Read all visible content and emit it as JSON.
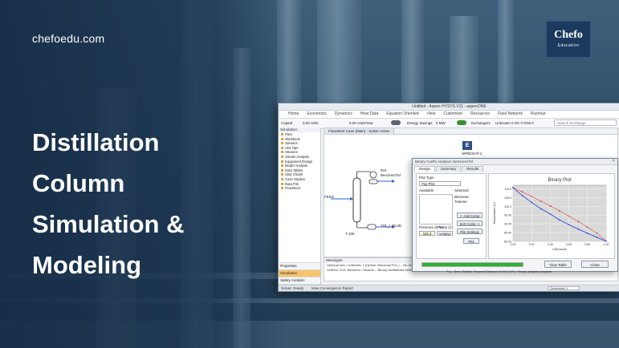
{
  "banner": {
    "site": "chefoedu.com",
    "title_lines": [
      "Distillation",
      "Column",
      "Simulation &",
      "Modeling"
    ],
    "logo_main": "Chefo",
    "logo_sub": "Education"
  },
  "window": {
    "title": "Untitled - Aspen HYSYS V11 - aspenONE",
    "menu": [
      "Home",
      "Economics",
      "Dynamics",
      "Heat Data",
      "Equation Oriented",
      "View",
      "Customize",
      "Resources",
      "Flare Network",
      "Rushout"
    ],
    "ribbon": {
      "cost_label": "Capital",
      "cost_value": "0.00 USD",
      "utility_value": "0.00 USD/Year",
      "energy_label": "Energy Savings",
      "energy_value": "0 MW",
      "exchangers_label": "Exchangers",
      "exchangers_status": "Unknown 0  OK 0  Risk 0",
      "search_placeholder": "Search Exchange"
    },
    "nav": {
      "head": "Simulation",
      "items": [
        "Files",
        "Workbook",
        "Streams",
        "Unit Ops",
        "Streams",
        "Stream Analysis",
        "Equipment Design",
        "Model Analysis",
        "Data Tables",
        "Strip Charts",
        "Case Studies",
        "Data Fits",
        "Flowsheet"
      ],
      "bottom": [
        "Properties",
        "Simulation",
        "Safety Analysis",
        "Energy Analysis"
      ]
    },
    "flowsheet": {
      "tab": "Flowsheet Case (Main) - Solver Active",
      "e_label": "E",
      "spreadsheet_label": "SPRDSHT-1",
      "feed": "FEED",
      "top": "DIS",
      "top_sub": "Benzene/Tol",
      "bottom": "TOL_LIQUID",
      "column": "T-100"
    },
    "messages": {
      "head": "Messages",
      "lines": [
        "Optional Info = Intervals: 1 (Option: Benzene/TOL-) -- No Solution",
        "UNIFAC-VLE, Benzene / Toluene -- Binary coefficients estimated"
      ]
    },
    "status": {
      "left": "Solver: Ready",
      "center": "View Convergence Report",
      "zoom": "Generated: 1"
    }
  },
  "dialog": {
    "title": "Binary Coeffs Analysis: Benzene/Tol",
    "tabs": [
      "Design",
      "Summary",
      "Results"
    ],
    "plot_label": "Plot Type",
    "plot_select": "Txy Plot",
    "available_label": "Available",
    "selected_label": "Selected",
    "selected_items": [
      "Benzene",
      "Toluene"
    ],
    "pressure_label": "Pressure (kPa)",
    "pressure_value": "101.3",
    "temp_label": "Temp (C)",
    "temp_value": "<empty>",
    "buttons": [
      "<- Add Comp",
      "Sort Comp ->",
      "Plot Settings",
      "Plot"
    ],
    "progress": 1.0,
    "view_button": "View Table",
    "close_button": "Close",
    "bottom_notes": "Txy - Dew / Bubble, Benzene/Toluene at 101.3 kPa - Binary analysis complete"
  },
  "chart_data": {
    "type": "line",
    "title": "Binary Plot",
    "xlabel": "x Benzene",
    "ylabel": "Temperature (C)",
    "xlim": [
      0.0,
      1.0
    ],
    "ylim": [
      80.0,
      112.0
    ],
    "x": [
      0.0,
      0.1,
      0.2,
      0.3,
      0.4,
      0.5,
      0.6,
      0.7,
      0.8,
      0.9,
      1.0
    ],
    "series": [
      {
        "color": "#e23b3b",
        "values": [
          110.6,
          108.2,
          105.6,
          102.9,
          100.2,
          97.4,
          94.4,
          91.3,
          88.1,
          84.7,
          80.1
        ]
      },
      {
        "color": "#2f4fd8",
        "values": [
          110.6,
          106.1,
          102.2,
          98.6,
          95.6,
          92.2,
          89.5,
          87.0,
          84.6,
          82.3,
          80.1
        ]
      }
    ],
    "x_ticks": [
      "0.00",
      "0.20",
      "0.40",
      "0.60",
      "0.80",
      "1.00"
    ],
    "y_ticks": [
      "80.00",
      "85.00",
      "90.00",
      "95.00",
      "100.0",
      "105.0",
      "110.0"
    ],
    "grid": true
  },
  "colors": {
    "overlay": "#1b3450",
    "accent": "#f6c46a",
    "progress": "#2db22d"
  }
}
